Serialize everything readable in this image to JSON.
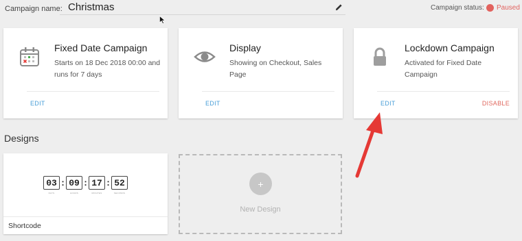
{
  "header": {
    "campaign_name_label": "Campaign name:",
    "campaign_name_value": "Christmas",
    "edit_icon": "pencil-icon",
    "status_label": "Campaign status:",
    "status_value": "Paused",
    "status_color": "#e2625e"
  },
  "cards": [
    {
      "icon": "calendar-icon",
      "title": "Fixed Date Campaign",
      "description": "Starts on 18 Dec 2018 00:00 and runs for 7 days",
      "edit_label": "EDIT"
    },
    {
      "icon": "eye-icon",
      "title": "Display",
      "description": "Showing on Checkout, Sales Page",
      "edit_label": "EDIT"
    },
    {
      "icon": "lock-icon",
      "title": "Lockdown Campaign",
      "description": "Activated for Fixed Date Campaign",
      "edit_label": "EDIT",
      "disable_label": "DISABLE"
    }
  ],
  "designs": {
    "section_title": "Designs",
    "items": [
      {
        "countdown": [
          {
            "value": "03",
            "caption": "DAYS"
          },
          {
            "value": "09",
            "caption": "HOURS"
          },
          {
            "value": "17",
            "caption": "MINUTES"
          },
          {
            "value": "52",
            "caption": "SECONDS"
          }
        ],
        "label": "Shortcode"
      }
    ],
    "new_design_label": "New Design",
    "new_design_icon": "plus-icon"
  },
  "colors": {
    "accent_blue": "#4a9fd8",
    "danger_red": "#e0685e",
    "annotation_arrow": "#e53935"
  }
}
